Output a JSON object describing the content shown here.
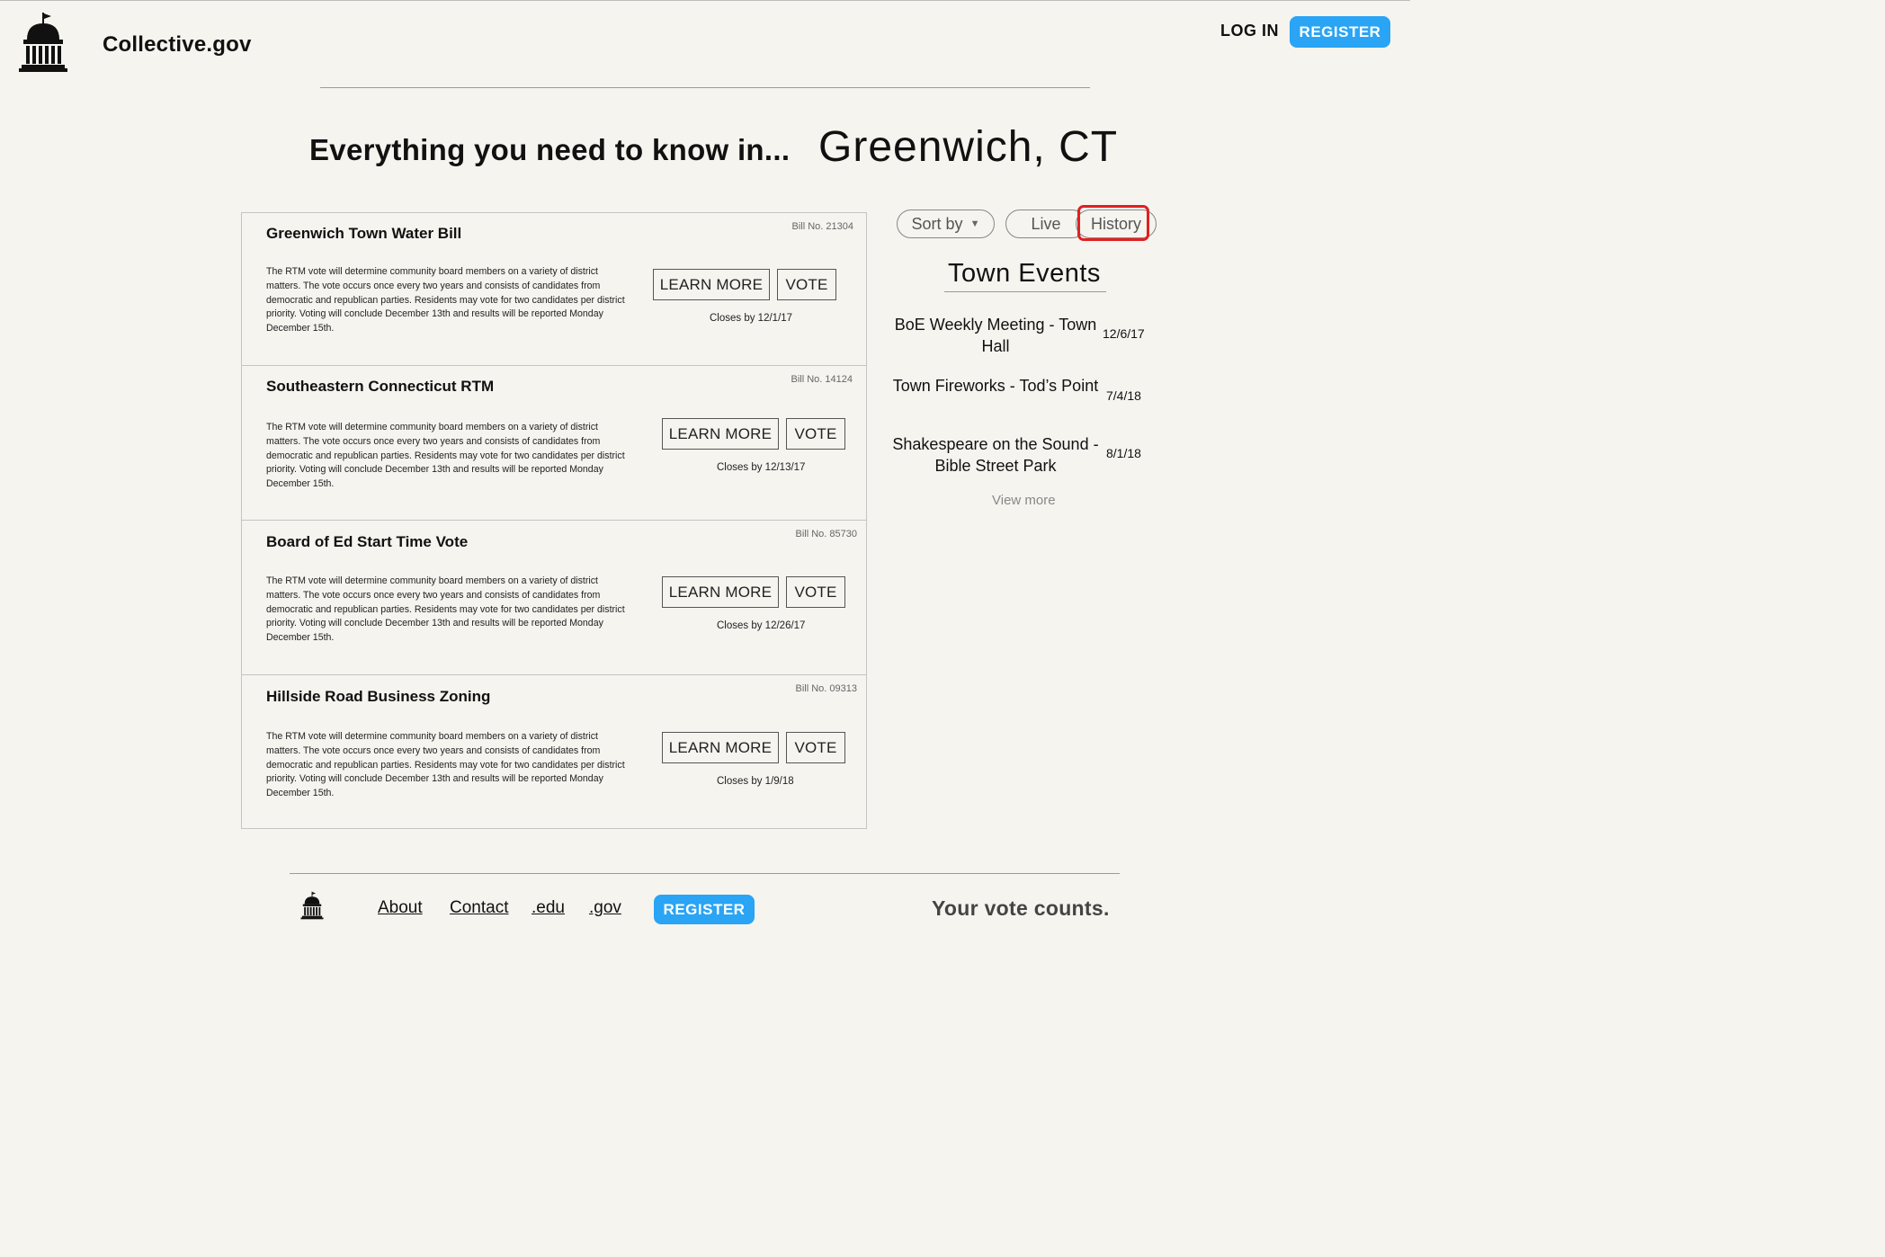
{
  "header": {
    "site_name": "Collective.gov",
    "login_label": "LOG IN",
    "register_label": "REGISTER"
  },
  "hero": {
    "text": "Everything you need to know in...",
    "city": "Greenwich, CT"
  },
  "bills": [
    {
      "bill_no": "Bill No. 21304",
      "title": "Greenwich Town Water Bill",
      "description": "The RTM vote will determine community board members on a variety of district matters. The vote occurs once every two years and consists of candidates from democratic and republican parties. Residents may vote for two candidates per district priority. Voting will conclude December 13th and results will be reported Monday December 15th.",
      "learn_more": "LEARN MORE",
      "vote": "VOTE",
      "closes": "Closes by 12/1/17"
    },
    {
      "bill_no": "Bill No. 14124",
      "title": "Southeastern Connecticut RTM",
      "description": "The RTM vote will determine community board members on a variety of district matters. The vote occurs once every two years and consists of candidates from democratic and republican parties. Residents may vote for two candidates per district priority. Voting will conclude December 13th and results will be reported Monday December 15th.",
      "learn_more": "LEARN MORE",
      "vote": "VOTE",
      "closes": "Closes by 12/13/17"
    },
    {
      "bill_no": "Bill No. 85730",
      "title": "Board of Ed Start Time Vote",
      "description": "The RTM vote will determine community board members on a variety of district matters. The vote occurs once every two years and consists of candidates from democratic and republican parties. Residents may vote for two candidates per district priority. Voting will conclude December 13th and results will be reported Monday December 15th.",
      "learn_more": "LEARN MORE",
      "vote": "VOTE",
      "closes": "Closes by 12/26/17"
    },
    {
      "bill_no": "Bill No. 09313",
      "title": "Hillside Road Business Zoning",
      "description": "The RTM vote will determine community board members on a variety of district matters. The vote occurs once every two years and consists of candidates from democratic and republican parties. Residents may vote for two candidates per district priority. Voting will conclude December 13th and results will be reported Monday December 15th.",
      "learn_more": "LEARN MORE",
      "vote": "VOTE",
      "closes": "Closes by 1/9/18"
    }
  ],
  "filters": {
    "sort_label": "Sort by",
    "live_label": "Live",
    "history_label": "History"
  },
  "events": {
    "title": "Town Events",
    "items": [
      {
        "name": "BoE Weekly Meeting - Town Hall",
        "date": "12/6/17"
      },
      {
        "name": "Town Fireworks - Tod’s Point",
        "date": "7/4/18"
      },
      {
        "name": "Shakespeare on the Sound - Bible Street Park",
        "date": "8/1/18"
      }
    ],
    "view_more": "View more"
  },
  "footer": {
    "links": [
      "About",
      "Contact",
      ".edu",
      ".gov"
    ],
    "register_label": "REGISTER",
    "slogan": "Your vote counts."
  },
  "colors": {
    "background": "#f5f4ef",
    "accent": "#2aa4f4",
    "highlight": "#e02020"
  },
  "icons": {
    "logo": "capitol-building-icon",
    "sort_caret": "caret-down-icon"
  }
}
